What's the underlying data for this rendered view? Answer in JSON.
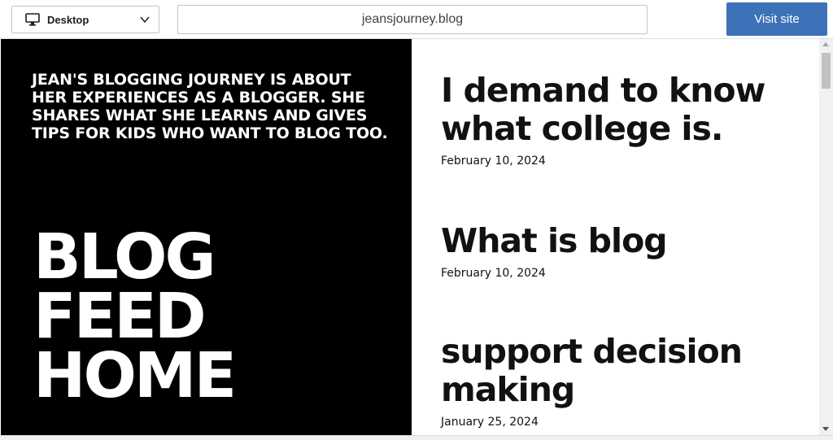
{
  "toolbar": {
    "device_label": "Desktop",
    "device_icon": "desktop-monitor-icon",
    "url": "jeansjourney.blog",
    "visit_label": "Visit site",
    "visit_color": "#3d72b8"
  },
  "site": {
    "intro": "JEAN'S BLOGGING JOURNEY IS ABOUT HER EXPERIENCES AS A BLOGGER. SHE SHARES WHAT SHE LEARNS AND GIVES TIPS FOR KIDS WHO WANT TO BLOG TOO.",
    "title_lines": [
      "BLOG",
      "FEED",
      "HOME"
    ],
    "posts": [
      {
        "title": "I demand to know what college is.",
        "date": "February 10, 2024"
      },
      {
        "title": "What is blog",
        "date": "February 10, 2024"
      },
      {
        "title": "support decision making",
        "date": "January 25, 2024"
      }
    ]
  }
}
